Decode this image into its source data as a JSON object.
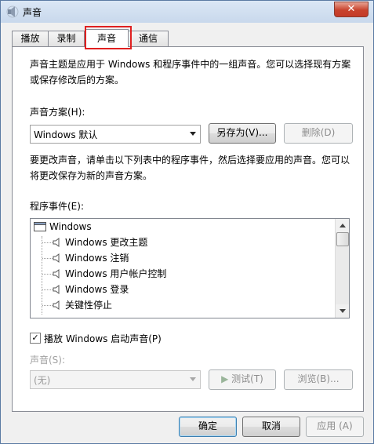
{
  "window": {
    "title": "声音",
    "close_label": "✕"
  },
  "tabs": [
    {
      "label": "播放"
    },
    {
      "label": "录制"
    },
    {
      "label": "声音"
    },
    {
      "label": "通信"
    }
  ],
  "panel": {
    "intro_text": "声音主题是应用于 Windows 和程序事件中的一组声音。您可以选择现有方案或保存修改后的方案。",
    "scheme_label": "声音方案(H):",
    "scheme_value": "Windows 默认",
    "save_as_button": "另存为(V)...",
    "delete_button": "删除(D)",
    "change_text": "要更改声音，请单击以下列表中的程序事件，然后选择要应用的声音。您可以将更改保存为新的声音方案。",
    "events_label": "程序事件(E):",
    "events_root": "Windows",
    "events": [
      "Windows 更改主题",
      "Windows 注销",
      "Windows 用户帐户控制",
      "Windows 登录",
      "关键性停止"
    ],
    "startup_checkbox_label": "播放 Windows 启动声音(P)",
    "startup_checked": true,
    "sounds_label": "声音(S):",
    "sound_value": "(无)",
    "test_button": "测试(T)",
    "browse_button": "浏览(B)..."
  },
  "footer": {
    "ok_button": "确定",
    "cancel_button": "取消",
    "apply_button": "应用 (A)"
  }
}
